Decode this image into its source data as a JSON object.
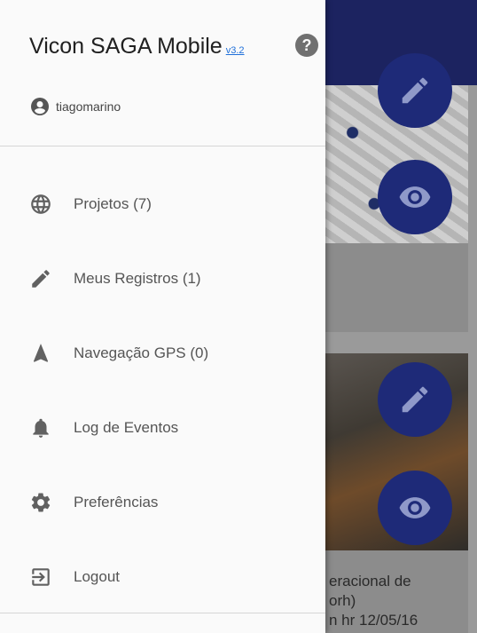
{
  "drawer": {
    "app_title": "Vicon SAGA Mobile",
    "version": "v3.2",
    "user": "tiagomarino",
    "menu": [
      {
        "label": "Projetos (7)",
        "icon": "globe-icon"
      },
      {
        "label": "Meus Registros (1)",
        "icon": "pencil-icon"
      },
      {
        "label": "Navegação GPS (0)",
        "icon": "navigation-arrow-icon"
      },
      {
        "label": "Log de Eventos",
        "icon": "bell-icon"
      },
      {
        "label": "Preferências",
        "icon": "gear-icon"
      },
      {
        "label": "Logout",
        "icon": "logout-icon"
      }
    ]
  },
  "background": {
    "card2_caption": "eracional de\norh)\nn hr 12/05/16"
  },
  "colors": {
    "appbar": "#1c2360",
    "fab": "#1e2a78",
    "drawer_bg": "#fafafa",
    "link": "#1e6fd9"
  }
}
